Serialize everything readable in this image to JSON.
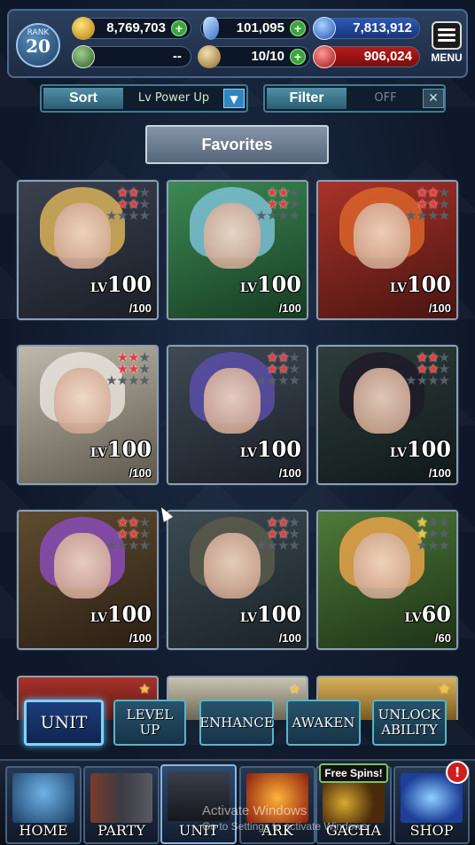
{
  "header": {
    "rank_label": "RANK",
    "rank_value": "20",
    "gold": "8,769,703",
    "crystals": "101,095",
    "blue_orbs": "7,813,912",
    "guild_value": "--",
    "stamina": "10/10",
    "red_orbs": "906,024",
    "menu_label": "MENU",
    "plus_symbol": "+"
  },
  "controls": {
    "sort_label": "Sort",
    "sort_value": "Lv Power Up",
    "filter_label": "Filter",
    "filter_value": "OFF",
    "dropdown_symbol": "▼",
    "clear_symbol": "✕"
  },
  "favorites_label": "Favorites",
  "units": [
    {
      "lv_prefix": "LV",
      "level": "100",
      "max": "/100",
      "stars": "red6"
    },
    {
      "lv_prefix": "LV",
      "level": "100",
      "max": "/100",
      "stars": "red6"
    },
    {
      "lv_prefix": "LV",
      "level": "100",
      "max": "/100",
      "stars": "red6"
    },
    {
      "lv_prefix": "LV",
      "level": "100",
      "max": "/100",
      "stars": "red6"
    },
    {
      "lv_prefix": "LV",
      "level": "100",
      "max": "/100",
      "stars": "red6"
    },
    {
      "lv_prefix": "LV",
      "level": "100",
      "max": "/100",
      "stars": "red6"
    },
    {
      "lv_prefix": "LV",
      "level": "100",
      "max": "/100",
      "stars": "red6"
    },
    {
      "lv_prefix": "LV",
      "level": "100",
      "max": "/100",
      "stars": "red6"
    },
    {
      "lv_prefix": "LV",
      "level": "60",
      "max": "/60",
      "stars": "gold3"
    }
  ],
  "sub_tabs": [
    "UNIT",
    "LEVEL UP",
    "ENHANCE",
    "AWAKEN",
    "UNLOCK ABILITY"
  ],
  "nav": {
    "home": "HOME",
    "party": "PARTY",
    "unit": "UNIT",
    "ark": "ARK",
    "gacha": "GACHA",
    "shop": "SHOP",
    "free_spins": "Free Spins!",
    "shop_badge": "!"
  },
  "watermark": {
    "line1": "Activate Windows",
    "line2": "Go to Settings to activate Windows."
  },
  "colors": {
    "star_red": "#e83a3a",
    "star_gold": "#f2c230",
    "accent_cyan": "#55b6c9",
    "active_tab_glow": "#7fd3ff"
  }
}
